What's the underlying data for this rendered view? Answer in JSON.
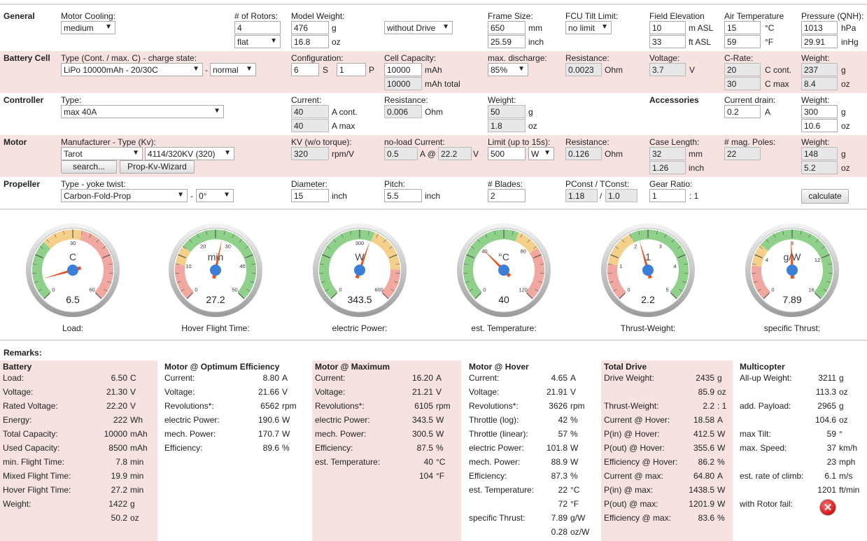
{
  "general": {
    "label": "General",
    "motor_cooling_label": "Motor Cooling:",
    "motor_cooling": "medium",
    "rotors_label": "# of Rotors:",
    "rotors": "4",
    "rotor_layout": "flat",
    "model_weight_label": "Model Weight:",
    "model_weight_g": "476",
    "model_weight_oz": "16.8",
    "drive_mode": "without Drive",
    "frame_size_label": "Frame Size:",
    "frame_size_mm": "650",
    "frame_size_inch": "25.59",
    "fcu_tilt_label": "FCU Tilt Limit:",
    "fcu_tilt": "no limit",
    "field_elev_label": "Field Elevation",
    "field_elev_m": "10",
    "field_elev_ft": "33",
    "air_temp_label": "Air Temperature",
    "air_temp_c": "15",
    "air_temp_f": "59",
    "pressure_label": "Pressure (QNH):",
    "pressure_hpa": "1013",
    "pressure_inhg": "29.91"
  },
  "battery": {
    "label": "Battery Cell",
    "type_label": "Type (Cont. / max. C) - charge state:",
    "type": "LiPo 10000mAh - 20/30C",
    "charge_state": "normal",
    "config_label": "Configuration:",
    "config_s": "6",
    "config_p": "1",
    "capacity_label": "Cell Capacity:",
    "capacity": "10000",
    "capacity_total": "10000",
    "max_discharge_label": "max. discharge:",
    "max_discharge": "85%",
    "resistance_label": "Resistance:",
    "resistance": "0.0023",
    "voltage_label": "Voltage:",
    "voltage": "3.7",
    "crate_label": "C-Rate:",
    "crate_cont": "20",
    "crate_max": "30",
    "weight_label": "Weight:",
    "weight_g": "237",
    "weight_oz": "8.4"
  },
  "controller": {
    "label": "Controller",
    "type_label": "Type:",
    "type": "max 40A",
    "current_label": "Current:",
    "current_cont": "40",
    "current_max": "40",
    "resistance_label": "Resistance:",
    "resistance": "0.006",
    "weight_label": "Weight:",
    "weight_g": "50",
    "weight_oz": "1.8",
    "accessories_label": "Accessories",
    "drain_label": "Current drain:",
    "drain": "0.2",
    "acc_weight_label": "Weight:",
    "acc_weight_g": "300",
    "acc_weight_oz": "10.6"
  },
  "motor": {
    "label": "Motor",
    "type_label": "Manufacturer - Type (Kv):",
    "manufacturer": "Tarot",
    "type": "4114/320KV (320)",
    "search_btn": "search...",
    "wizard_btn": "Prop-Kv-Wizard",
    "kv_label": "KV (w/o torque):",
    "kv": "320",
    "noload_label": "no-load Current:",
    "noload_a": "0.5",
    "noload_v": "22.2",
    "limit_label": "Limit (up to 15s):",
    "limit": "500",
    "limit_unit": "W",
    "resistance_label": "Resistance:",
    "resistance": "0.126",
    "case_label": "Case Length:",
    "case_mm": "32",
    "case_inch": "1.26",
    "poles_label": "# mag. Poles:",
    "poles": "22",
    "weight_label": "Weight:",
    "weight_g": "148",
    "weight_oz": "5.2"
  },
  "propeller": {
    "label": "Propeller",
    "type_label": "Type - yoke twist:",
    "type": "Carbon-Fold-Prop",
    "twist": "0°",
    "diameter_label": "Diameter:",
    "diameter": "15",
    "pitch_label": "Pitch:",
    "pitch": "5.5",
    "blades_label": "# Blades:",
    "blades": "2",
    "pconst_label": "PConst / TConst:",
    "pconst": "1.18",
    "tconst": "1.0",
    "gear_label": "Gear Ratio:",
    "gear": "1",
    "calculate_btn": "calculate"
  },
  "units": {
    "g": "g",
    "oz": "oz",
    "mm": "mm",
    "inch": "inch",
    "m_asl": "m ASL",
    "ft_asl": "ft ASL",
    "deg_c": "°C",
    "deg_f": "°F",
    "hpa": "hPa",
    "inhg": "inHg",
    "S": "S",
    "P": "P",
    "mah": "mAh",
    "mah_total": "mAh total",
    "ohm": "Ohm",
    "V": "V",
    "ccont": "C cont.",
    "cmax": "C max",
    "acont": "A cont.",
    "amax": "A max",
    "A": "A",
    "rpmv": "rpm/V",
    "a_at": "A @",
    "ratio": ": 1",
    "slash": "/",
    "dash": "-"
  },
  "gauges": [
    {
      "unit": "C",
      "value": "6.5",
      "label": "Load:",
      "ticks": [
        {
          "t": "0",
          "f": 0
        },
        {
          "t": "30",
          "f": 0.5
        },
        {
          "t": "60",
          "f": 1
        }
      ],
      "needle": 0.1083,
      "zones": [
        [
          0,
          0.33,
          "#8fd18a"
        ],
        [
          0.33,
          0.55,
          "#f5d08a"
        ],
        [
          0.55,
          1,
          "#f0a8a0"
        ]
      ]
    },
    {
      "unit": "min",
      "value": "27.2",
      "label": "Hover Flight Time:",
      "ticks": [
        {
          "t": "0",
          "f": 0
        },
        {
          "t": "10",
          "f": 0.2
        },
        {
          "t": "20",
          "f": 0.4
        },
        {
          "t": "30",
          "f": 0.6
        },
        {
          "t": "40",
          "f": 0.8
        },
        {
          "t": "50",
          "f": 1
        }
      ],
      "needle": 0.544,
      "zones": [
        [
          0,
          0.2,
          "#f0a8a0"
        ],
        [
          0.2,
          0.3,
          "#f5d08a"
        ],
        [
          0.3,
          1,
          "#8fd18a"
        ]
      ]
    },
    {
      "unit": "W",
      "value": "343.5",
      "label": "electric Power:",
      "ticks": [
        {
          "t": "0",
          "f": 0
        },
        {
          "t": "300",
          "f": 0.5
        },
        {
          "t": "600",
          "f": 1
        }
      ],
      "needle": 0.5725,
      "zones": [
        [
          0,
          0.58,
          "#8fd18a"
        ],
        [
          0.58,
          0.83,
          "#f5d08a"
        ],
        [
          0.83,
          1,
          "#f0a8a0"
        ]
      ]
    },
    {
      "unit": "°C",
      "value": "40",
      "label": "est. Temperature:",
      "ticks": [
        {
          "t": "0",
          "f": 0
        },
        {
          "t": "40",
          "f": 0.333
        },
        {
          "t": "80",
          "f": 0.667
        },
        {
          "t": "120",
          "f": 1
        }
      ],
      "needle": 0.333,
      "zones": [
        [
          0,
          0.58,
          "#8fd18a"
        ],
        [
          0.58,
          0.71,
          "#f5d08a"
        ],
        [
          0.71,
          1,
          "#f0a8a0"
        ]
      ]
    },
    {
      "unit": "1",
      "value": "2.2",
      "label": "Thrust-Weight:",
      "ticks": [
        {
          "t": "0",
          "f": 0
        },
        {
          "t": "1",
          "f": 0.2
        },
        {
          "t": "2",
          "f": 0.4
        },
        {
          "t": "3",
          "f": 0.6
        },
        {
          "t": "4",
          "f": 0.8
        },
        {
          "t": "5",
          "f": 1
        }
      ],
      "needle": 0.44,
      "zones": [
        [
          0,
          0.2,
          "#f0a8a0"
        ],
        [
          0.2,
          0.4,
          "#f5d08a"
        ],
        [
          0.4,
          1,
          "#8fd18a"
        ]
      ]
    },
    {
      "unit": "g/W",
      "value": "7.89",
      "label": "specific Thrust:",
      "ticks": [
        {
          "t": "0",
          "f": 0
        },
        {
          "t": "4",
          "f": 0.25
        },
        {
          "t": "8",
          "f": 0.5
        },
        {
          "t": "12",
          "f": 0.75
        },
        {
          "t": "16",
          "f": 1
        }
      ],
      "needle": 0.493,
      "zones": [
        [
          0,
          0.19,
          "#f0a8a0"
        ],
        [
          0.19,
          0.31,
          "#f5d08a"
        ],
        [
          0.31,
          1,
          "#8fd18a"
        ]
      ]
    }
  ],
  "remarks_label": "Remarks:",
  "results": [
    {
      "title": "Battery",
      "pink": true,
      "rows": [
        [
          "Load:",
          "6.50",
          "C"
        ],
        [
          "Voltage:",
          "21.30",
          "V"
        ],
        [
          "Rated Voltage:",
          "22.20",
          "V"
        ],
        [
          "Energy:",
          "222",
          "Wh"
        ],
        [
          "Total Capacity:",
          "10000",
          "mAh"
        ],
        [
          "Used Capacity:",
          "8500",
          "mAh"
        ],
        [
          "min. Flight Time:",
          "7.8",
          "min"
        ],
        [
          "Mixed Flight Time:",
          "19.9",
          "min"
        ],
        [
          "Hover Flight Time:",
          "27.2",
          "min"
        ],
        [
          "Weight:",
          "1422",
          "g"
        ],
        [
          "",
          "50.2",
          "oz"
        ]
      ]
    },
    {
      "title": "Motor @ Optimum Efficiency",
      "pink": false,
      "rows": [
        [
          "Current:",
          "8.80",
          "A"
        ],
        [
          "Voltage:",
          "21.66",
          "V"
        ],
        [
          "Revolutions*:",
          "6562",
          "rpm"
        ],
        [
          "electric Power:",
          "190.6",
          "W"
        ],
        [
          "mech. Power:",
          "170.7",
          "W"
        ],
        [
          "Efficiency:",
          "89.6",
          "%"
        ]
      ]
    },
    {
      "title": "Motor @ Maximum",
      "pink": true,
      "rows": [
        [
          "Current:",
          "16.20",
          "A"
        ],
        [
          "Voltage:",
          "21.21",
          "V"
        ],
        [
          "Revolutions*:",
          "6105",
          "rpm"
        ],
        [
          "electric Power:",
          "343.5",
          "W"
        ],
        [
          "mech. Power:",
          "300.5",
          "W"
        ],
        [
          "Efficiency:",
          "87.5",
          "%"
        ],
        [
          "est. Temperature:",
          "40",
          "°C"
        ],
        [
          "",
          "104",
          "°F"
        ]
      ]
    },
    {
      "title": "Motor @ Hover",
      "pink": false,
      "rows": [
        [
          "Current:",
          "4.65",
          "A"
        ],
        [
          "Voltage:",
          "21.91",
          "V"
        ],
        [
          "Revolutions*:",
          "3626",
          "rpm"
        ],
        [
          "Throttle (log):",
          "42",
          "%"
        ],
        [
          "Throttle (linear):",
          "57",
          "%"
        ],
        [
          "electric Power:",
          "101.8",
          "W"
        ],
        [
          "mech. Power:",
          "88.9",
          "W"
        ],
        [
          "Efficiency:",
          "87.3",
          "%"
        ],
        [
          "est. Temperature:",
          "22",
          "°C"
        ],
        [
          "",
          "72",
          "°F"
        ],
        [
          "specific Thrust:",
          "7.89",
          "g/W"
        ],
        [
          "",
          "0.28",
          "oz/W"
        ]
      ]
    },
    {
      "title": "Total Drive",
      "pink": true,
      "rows": [
        [
          "Drive Weight:",
          "2435",
          "g"
        ],
        [
          "",
          "85.9",
          "oz"
        ],
        [
          "Thrust-Weight:",
          "2.2",
          "1"
        ],
        [
          "Current @ Hover:",
          "18.58",
          "A"
        ],
        [
          "P(in) @ Hover:",
          "412.5",
          "W"
        ],
        [
          "P(out) @ Hover:",
          "355.6",
          "W"
        ],
        [
          "Efficiency @ Hover:",
          "86.2",
          "%"
        ],
        [
          "Current @ max:",
          "64.80",
          "A"
        ],
        [
          "P(in) @ max:",
          "1438.5",
          "W"
        ],
        [
          "P(out) @ max:",
          "1201.9",
          "W"
        ],
        [
          "Efficiency @ max:",
          "83.6",
          "%"
        ]
      ]
    },
    {
      "title": "Multicopter",
      "pink": false,
      "rows": [
        [
          "All-up Weight:",
          "3211",
          "g"
        ],
        [
          "",
          "113.3",
          "oz"
        ],
        [
          "add. Payload:",
          "2965",
          "g"
        ],
        [
          "",
          "104.6",
          "oz"
        ],
        [
          "max Tilt:",
          "59",
          "°"
        ],
        [
          "max. Speed:",
          "37",
          "km/h"
        ],
        [
          "",
          "23",
          "mph"
        ],
        [
          "est. rate of climb:",
          "6.1",
          "m/s"
        ],
        [
          "",
          "1201",
          "ft/min"
        ],
        [
          "with Rotor fail:",
          "",
          ""
        ]
      ]
    }
  ],
  "colors": {
    "band": "#f7e2e2",
    "needle": "#e8501e",
    "hub": "#3b7fd9",
    "fail": "#d92020"
  }
}
